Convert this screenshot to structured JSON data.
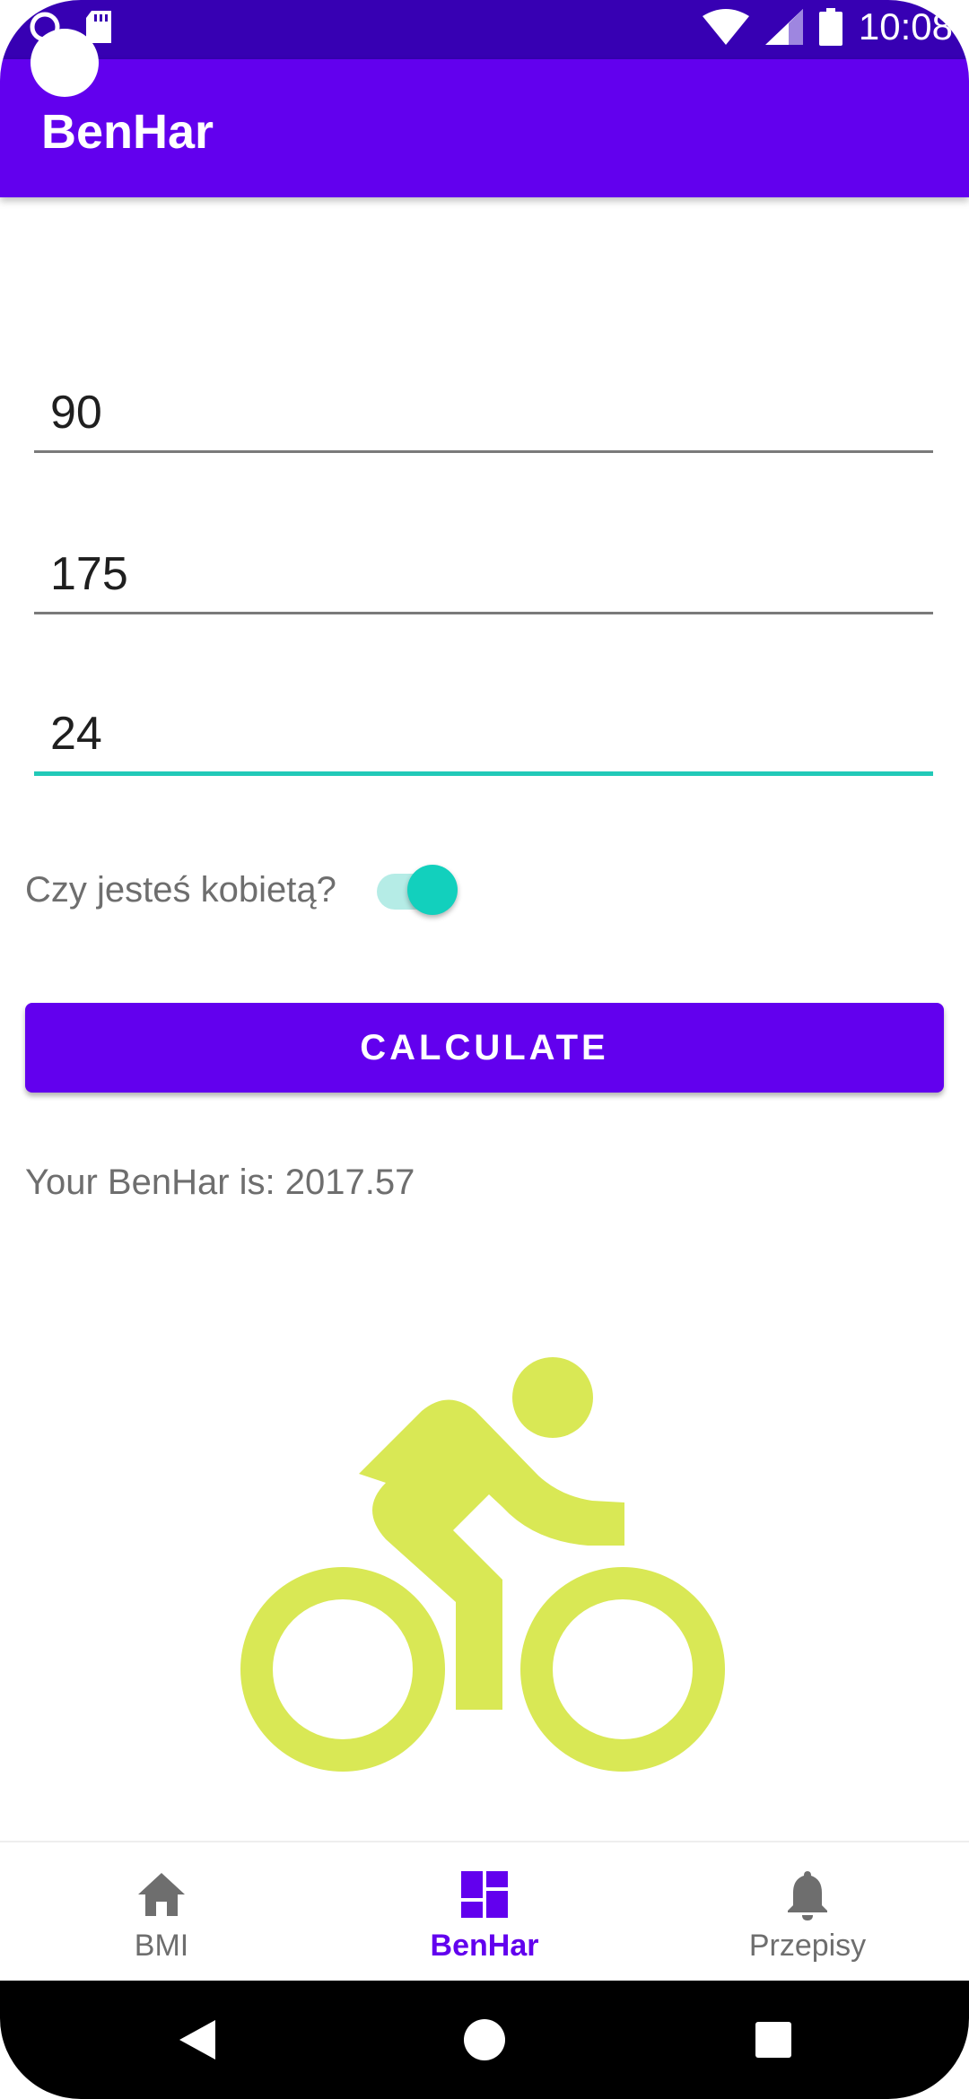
{
  "status_bar": {
    "time": "10:08"
  },
  "app_bar": {
    "title": "BenHar"
  },
  "form": {
    "weight_value": "90",
    "height_value": "175",
    "age_value": "24",
    "switch_label": "Czy jesteś kobietą?",
    "switch_on": true
  },
  "actions": {
    "calculate_label": "CALCULATE"
  },
  "result": {
    "text": "Your BenHar is: 2017.57"
  },
  "illustration": {
    "icon": "bike-icon",
    "color": "#d9e855"
  },
  "bottom_nav": {
    "items": [
      {
        "label": "BMI",
        "icon": "home-icon",
        "active": false
      },
      {
        "label": "BenHar",
        "icon": "dashboard-icon",
        "active": true
      },
      {
        "label": "Przepisy",
        "icon": "bell-icon",
        "active": false
      }
    ]
  },
  "colors": {
    "primary": "#6200ee",
    "primary_dark": "#3700b3",
    "accent": "#12d0bd"
  }
}
